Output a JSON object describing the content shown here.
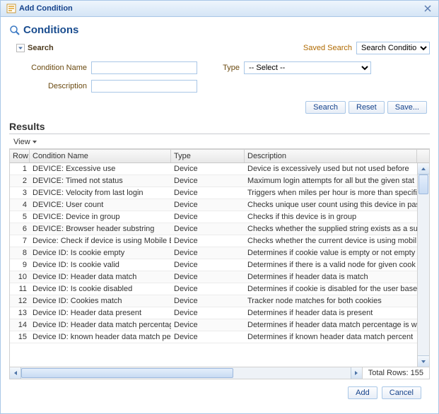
{
  "dialog": {
    "title": "Add Condition"
  },
  "section": {
    "title": "Conditions"
  },
  "search": {
    "header": "Search",
    "saved_label": "Saved Search",
    "saved_value": "Search Conditions",
    "condition_name_label": "Condition Name",
    "description_label": "Description",
    "type_label": "Type",
    "type_value": "-- Select --",
    "buttons": {
      "search": "Search",
      "reset": "Reset",
      "save": "Save..."
    }
  },
  "results": {
    "title": "Results",
    "view_label": "View",
    "columns": {
      "row": "Row",
      "name": "Condition Name",
      "type": "Type",
      "desc": "Description"
    },
    "rows": [
      {
        "n": "1",
        "name": "DEVICE: Excessive use",
        "type": "Device",
        "desc": "Device is excessively used but not used before"
      },
      {
        "n": "2",
        "name": "DEVICE: Timed not status",
        "type": "Device",
        "desc": "Maximum login attempts for all but the given stat"
      },
      {
        "n": "3",
        "name": "DEVICE: Velocity from last login",
        "type": "Device",
        "desc": "Triggers when miles per hour is more than specifi"
      },
      {
        "n": "4",
        "name": "DEVICE: User count",
        "type": "Device",
        "desc": "Checks unique user count using this device in pas"
      },
      {
        "n": "5",
        "name": "DEVICE: Device in group",
        "type": "Device",
        "desc": "Checks if this device is in group"
      },
      {
        "n": "6",
        "name": "DEVICE: Browser header substring",
        "type": "Device",
        "desc": "Checks whether the supplied string exists as a su"
      },
      {
        "n": "7",
        "name": "Device: Check if device is using Mobile Bro",
        "type": "Device",
        "desc": "Checks whether the current device is using mobil"
      },
      {
        "n": "8",
        "name": "Device ID: Is cookie empty",
        "type": "Device",
        "desc": "Determines if cookie value is empty or not empty"
      },
      {
        "n": "9",
        "name": "Device ID: Is cookie valid",
        "type": "Device",
        "desc": "Determines if there is a valid node for given cook"
      },
      {
        "n": "10",
        "name": "Device ID: Header data match",
        "type": "Device",
        "desc": "Determines if header data is match"
      },
      {
        "n": "11",
        "name": "Device ID: Is cookie disabled",
        "type": "Device",
        "desc": "Determines if cookie is disabled for the user base"
      },
      {
        "n": "12",
        "name": "Device ID: Cookies match",
        "type": "Device",
        "desc": "Tracker node matches for both cookies"
      },
      {
        "n": "13",
        "name": "Device ID: Header data present",
        "type": "Device",
        "desc": "Determines if header data is present"
      },
      {
        "n": "14",
        "name": "Device ID: Header data match percentage",
        "type": "Device",
        "desc": "Determines if header data match percentage is w"
      },
      {
        "n": "15",
        "name": "Device ID: known header data match perc",
        "type": "Device",
        "desc": "Determines if known header data match percent"
      }
    ],
    "total_label": "Total Rows:",
    "total_value": "155"
  },
  "footer": {
    "add": "Add",
    "cancel": "Cancel"
  }
}
